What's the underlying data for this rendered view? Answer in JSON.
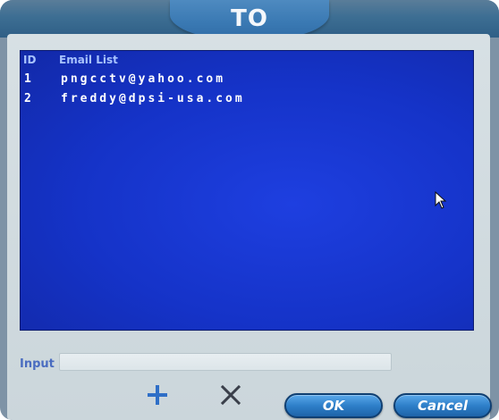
{
  "dialog": {
    "title": "TO"
  },
  "list": {
    "header_id": "ID",
    "header_email": "Email List",
    "rows": [
      {
        "id": "1",
        "email": "pngcctv@yahoo.com"
      },
      {
        "id": "2",
        "email": "freddy@dpsi-usa.com"
      }
    ]
  },
  "input": {
    "label": "Input",
    "value": ""
  },
  "buttons": {
    "add_glyph": "+",
    "delete_glyph": "×",
    "ok_label": "OK",
    "cancel_label": "Cancel"
  },
  "icons": {
    "add": "plus-icon",
    "delete": "x-icon",
    "pointer": "mouse-pointer-icon"
  },
  "colors": {
    "list_background": "#1533c8",
    "title_tab": "#3a79b3",
    "button_blue": "#2e7fc9",
    "header_text": "#a8c3ff",
    "input_label": "#4a6cc0"
  }
}
